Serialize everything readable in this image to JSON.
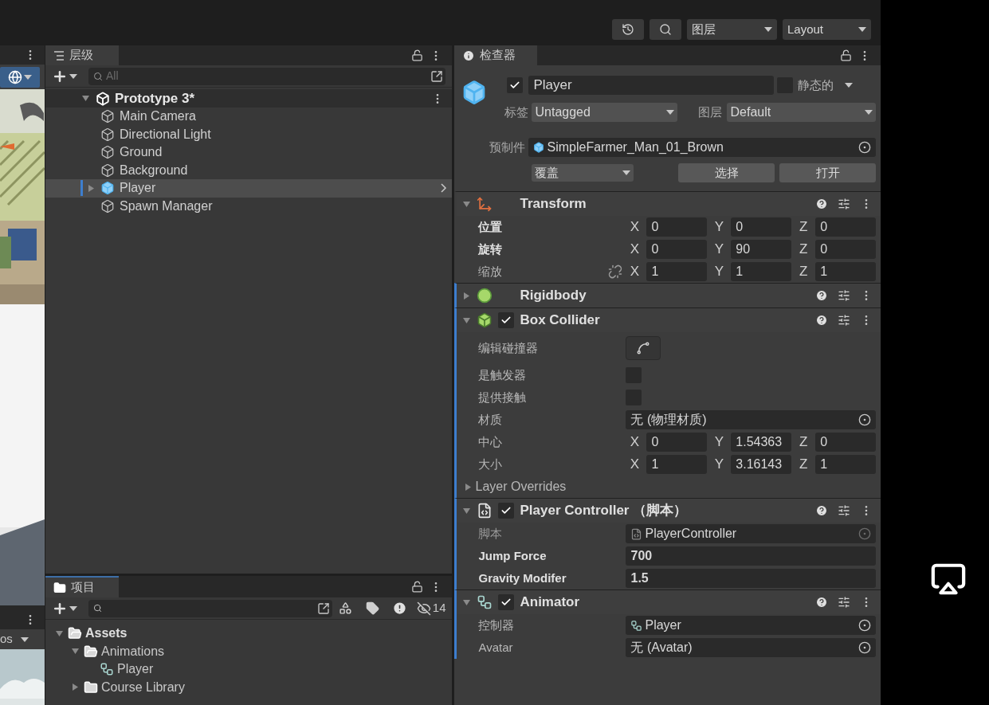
{
  "toolbar": {
    "buttons": [
      {
        "kind": "history"
      },
      {
        "kind": "search"
      }
    ],
    "layers_dropdown": "图层",
    "layout_dropdown": "Layout"
  },
  "scene_panel": {
    "gizmo_active": true,
    "view_dropdown": "os"
  },
  "hierarchy": {
    "tab": "层级",
    "search_placeholder": "All",
    "scene": {
      "name": "Prototype 3*",
      "expanded": true,
      "children": [
        {
          "name": "Main Camera",
          "kind": "object",
          "selected": false
        },
        {
          "name": "Directional Light",
          "kind": "object",
          "selected": false
        },
        {
          "name": "Ground",
          "kind": "object",
          "selected": false
        },
        {
          "name": "Background",
          "kind": "object",
          "selected": false
        },
        {
          "name": "Player",
          "kind": "prefab",
          "selected": true,
          "expanded": false
        },
        {
          "name": "Spawn Manager",
          "kind": "object",
          "selected": false
        }
      ]
    }
  },
  "project": {
    "tab": "项目",
    "hidden_count": "14",
    "tree": [
      {
        "name": "Assets",
        "kind": "folder",
        "expanded": true,
        "children": [
          {
            "name": "Animations",
            "kind": "folder",
            "expanded": true,
            "children": [
              {
                "name": "Player",
                "kind": "animator"
              }
            ]
          },
          {
            "name": "Course Library",
            "kind": "folder",
            "expanded": false
          }
        ]
      }
    ]
  },
  "inspector": {
    "tab": "检查器",
    "object": {
      "active": true,
      "name": "Player",
      "static": false,
      "static_label": "静态的",
      "tag_label": "标签",
      "tag": "Untagged",
      "layer_label": "图层",
      "layer": "Default",
      "prefab_label": "预制件",
      "prefab": "SimpleFarmer_Man_01_Brown",
      "overrides": "覆盖",
      "select": "选择",
      "open": "打开"
    },
    "components": [
      {
        "name": "Transform",
        "kind": "transform",
        "expanded": true,
        "added": false,
        "fields": [
          {
            "kind": "vector3",
            "label": "位置",
            "modified": true,
            "values": [
              {
                "axis": "X",
                "value": "0"
              },
              {
                "axis": "Y",
                "value": "0"
              },
              {
                "axis": "Z",
                "value": "0"
              }
            ]
          },
          {
            "kind": "vector3",
            "label": "旋转",
            "modified": true,
            "values": [
              {
                "axis": "X",
                "value": "0"
              },
              {
                "axis": "Y",
                "value": "90"
              },
              {
                "axis": "Z",
                "value": "0"
              }
            ]
          },
          {
            "kind": "vector3",
            "label": "缩放",
            "modified": false,
            "link": true,
            "values": [
              {
                "axis": "X",
                "value": "1"
              },
              {
                "axis": "Y",
                "value": "1"
              },
              {
                "axis": "Z",
                "value": "1"
              }
            ]
          }
        ]
      },
      {
        "name": "Rigidbody",
        "kind": "rigidbody",
        "expanded": false,
        "added": true
      },
      {
        "name": "Box Collider",
        "kind": "collider",
        "enabled": true,
        "expanded": true,
        "added": true,
        "fields": [
          {
            "kind": "edit",
            "label": "编辑碰撞器"
          },
          {
            "kind": "checkbox",
            "label": "是触发器",
            "checked": false
          },
          {
            "kind": "checkbox",
            "label": "提供接触",
            "checked": false
          },
          {
            "kind": "object",
            "label": "材质",
            "value": "无 (物理材质)"
          },
          {
            "kind": "vector3",
            "label": "中心",
            "modified": false,
            "values": [
              {
                "axis": "X",
                "value": "0"
              },
              {
                "axis": "Y",
                "value": "1.54363"
              },
              {
                "axis": "Z",
                "value": "0"
              }
            ]
          },
          {
            "kind": "vector3",
            "label": "大小",
            "modified": false,
            "values": [
              {
                "axis": "X",
                "value": "1"
              },
              {
                "axis": "Y",
                "value": "3.16143"
              },
              {
                "axis": "Z",
                "value": "1"
              }
            ]
          },
          {
            "kind": "foldout",
            "label": "Layer Overrides",
            "expanded": false
          }
        ]
      },
      {
        "name": "Player Controller （脚本）",
        "kind": "script",
        "enabled": true,
        "expanded": true,
        "added": true,
        "fields": [
          {
            "kind": "script_ref",
            "label": "脚本",
            "value": "PlayerController",
            "disabled": true
          },
          {
            "kind": "text",
            "label": "Jump Force",
            "value": "700",
            "modified": true
          },
          {
            "kind": "text",
            "label": "Gravity Modifer",
            "value": "1.5",
            "modified": true
          }
        ]
      },
      {
        "name": "Animator",
        "kind": "animator",
        "enabled": true,
        "expanded": true,
        "added": true,
        "fields": [
          {
            "kind": "controller_ref",
            "label": "控制器",
            "value": "Player"
          },
          {
            "kind": "object",
            "label": "Avatar",
            "value": "无 (Avatar)"
          }
        ]
      }
    ]
  },
  "overlay": {
    "cast_button": true
  }
}
